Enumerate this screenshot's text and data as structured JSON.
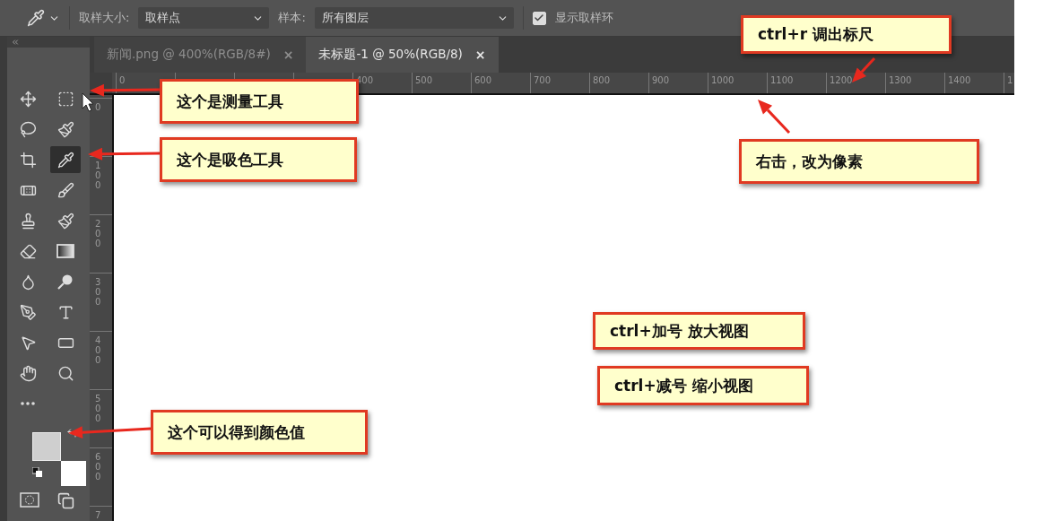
{
  "options_bar": {
    "sample_size_label": "取样大小:",
    "sample_size_value": "取样点",
    "sample_label": "样本:",
    "sample_value": "所有图层",
    "show_ring": {
      "label": "显示取样环",
      "checked": true
    }
  },
  "document_tabs": [
    {
      "title": "新闻.png @ 400%(RGB/8#)",
      "close": "×",
      "selected": false
    },
    {
      "title": "未标题-1 @ 50%(RGB/8)",
      "close": "×",
      "selected": true
    }
  ],
  "horizontal_ruler": {
    "origin": "0",
    "labels": [
      "400",
      "500",
      "600",
      "700",
      "800",
      "900",
      "1000",
      "1100",
      "1200",
      "1300",
      "1400",
      "1"
    ]
  },
  "vertical_ruler": {
    "labels": [
      "0",
      "100",
      "200",
      "300",
      "400",
      "500",
      "600",
      "7"
    ]
  },
  "tools": [
    {
      "kind": "move",
      "selected": false
    },
    {
      "kind": "marquee",
      "selected": false
    },
    {
      "kind": "lasso",
      "selected": false
    },
    {
      "kind": "quick-select",
      "selected": false
    },
    {
      "kind": "crop",
      "selected": false
    },
    {
      "kind": "eyedropper",
      "selected": true
    },
    {
      "kind": "healing",
      "selected": false
    },
    {
      "kind": "brush",
      "selected": false
    },
    {
      "kind": "stamp",
      "selected": false
    },
    {
      "kind": "history-brush",
      "selected": false
    },
    {
      "kind": "eraser",
      "selected": false
    },
    {
      "kind": "gradient",
      "selected": false
    },
    {
      "kind": "blur",
      "selected": false
    },
    {
      "kind": "dodge",
      "selected": false
    },
    {
      "kind": "pen",
      "selected": false
    },
    {
      "kind": "type",
      "selected": false
    },
    {
      "kind": "path-select",
      "selected": false
    },
    {
      "kind": "shape",
      "selected": false
    },
    {
      "kind": "hand",
      "selected": false
    },
    {
      "kind": "zoom",
      "selected": false
    },
    {
      "kind": "more",
      "selected": false
    }
  ],
  "callouts": [
    {
      "text": "这个是测量工具"
    },
    {
      "text": "这个是吸色工具"
    },
    {
      "text": "ctrl+r 调出标尺"
    },
    {
      "text": "右击，改为像素"
    },
    {
      "text": "ctrl+加号 放大视图"
    },
    {
      "text": "ctrl+减号 缩小视图"
    },
    {
      "text": "这个可以得到颜色值"
    }
  ]
}
